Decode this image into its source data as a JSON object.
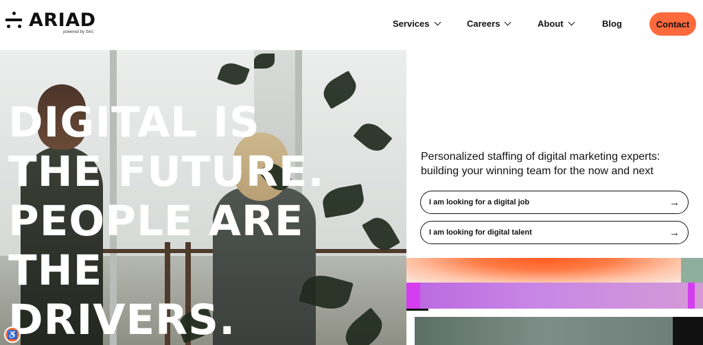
{
  "brand": {
    "name": "ARIAD",
    "tagline": "powered by Sinc"
  },
  "nav": {
    "items": [
      {
        "label": "Services",
        "has_dropdown": true
      },
      {
        "label": "Careers",
        "has_dropdown": true
      },
      {
        "label": "About",
        "has_dropdown": true
      },
      {
        "label": "Blog",
        "has_dropdown": false
      }
    ],
    "contact_label": "Contact"
  },
  "hero": {
    "lines": [
      "DIGITAL IS",
      "THE FUTURE.",
      "PEOPLE ARE",
      "THE",
      "DRIVERS."
    ]
  },
  "intro": {
    "line1": "Personalized staffing of digital marketing experts:",
    "line2": "building your winning team for the now and next"
  },
  "cta": {
    "job_label": "I am looking for a digital job",
    "talent_label": "I am looking for digital talent",
    "arrow": "→"
  },
  "colors": {
    "accent": "#ff6a3d",
    "text": "#111111",
    "gradient_purple": "#ba67e0",
    "gradient_orange": "#ff5a1f"
  }
}
